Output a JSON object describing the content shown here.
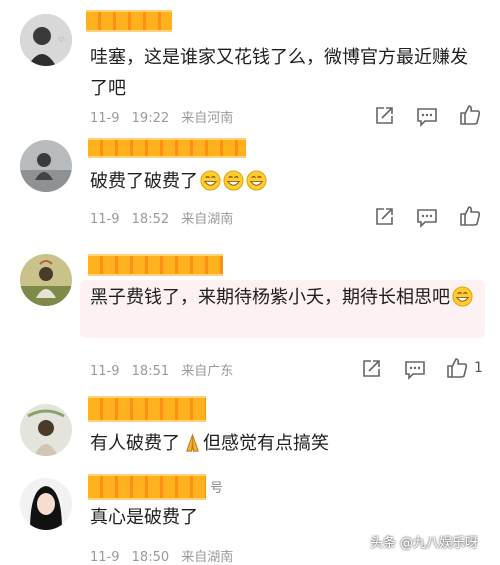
{
  "comments": [
    {
      "username_fragment": "",
      "text": "哇塞，这是谁家又花钱了么，微博官方最近赚发了吧",
      "date": "11-9",
      "time": "19:22",
      "source": "来自河南",
      "likes": ""
    },
    {
      "username_fragment": "",
      "text": "破费了破费了",
      "emoji": [
        "grin-emoji",
        "grin-emoji",
        "grin-emoji"
      ],
      "date": "11-9",
      "time": "18:52",
      "source": "来自湖南",
      "likes": ""
    },
    {
      "username_fragment": "",
      "text": "黑子费钱了，来期待杨紫小夭，期待长相思吧",
      "emoji": [
        "grin-emoji"
      ],
      "date": "11-9",
      "time": "18:51",
      "source": "来自广东",
      "likes": "1"
    },
    {
      "username_fragment": "",
      "text": "有人破费了",
      "text_after": "但感觉有点搞笑",
      "emoji": [
        "folded-hands-emoji"
      ]
    },
    {
      "username_fragment": "号",
      "text": "真心是破费了",
      "date": "11-9",
      "time": "18:50",
      "source": "来自湖南"
    }
  ],
  "watermark": "头条 @九八娱乐呀",
  "icons": {
    "share": "share-icon",
    "comment": "comment-icon",
    "like": "thumbs-up-icon"
  },
  "colors": {
    "name_mosaic": "#ffb21e",
    "highlight": "#fdf1f2",
    "meta": "#9a9a9a"
  }
}
